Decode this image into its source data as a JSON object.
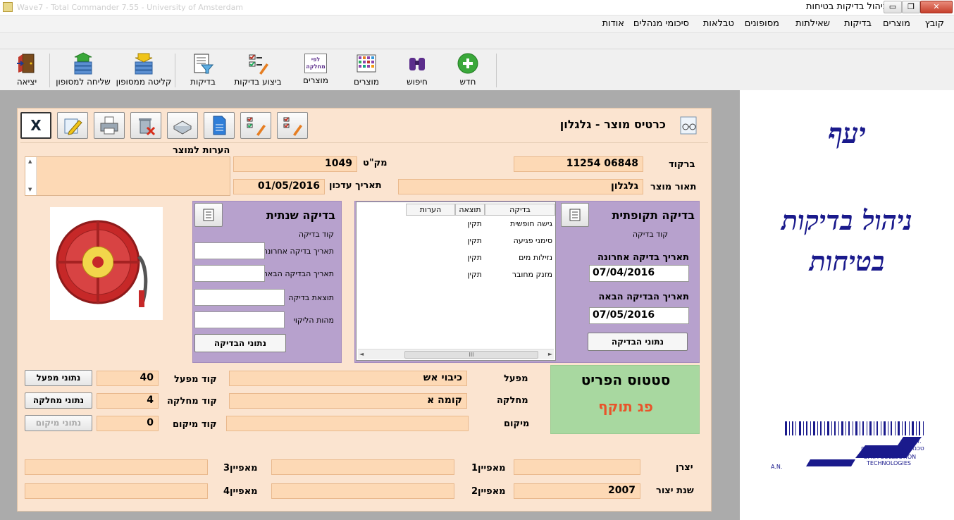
{
  "window": {
    "ghost_title": "Wave7 - Total Commander 7.55 - University of Amsterdam",
    "title": "ניהול בדיקות בטיחות",
    "buttons": {
      "minimize": "▭",
      "maximize": "❐",
      "close": "✕"
    }
  },
  "menu": [
    "קובץ",
    "מוצרים",
    "בדיקות",
    "שאילתות",
    "מסופונים",
    "טבלאות",
    "סיכומי מנהלים",
    "אודות"
  ],
  "toolbar": {
    "items": [
      {
        "label": "חדש",
        "icon": "add-circle-icon"
      },
      {
        "label": "חיפוש",
        "icon": "binoculars-icon"
      },
      {
        "label": "מוצרים",
        "icon": "grid-icon"
      },
      {
        "label": "מוצרים",
        "icon": "by-department-icon",
        "icon_text": "לפי מחלקה"
      },
      {
        "label": "ביצוע בדיקות",
        "icon": "checklist-pen-icon"
      },
      {
        "label": "בדיקות",
        "icon": "report-filter-icon"
      },
      {
        "label": "קליטה ממסופון",
        "icon": "import-stack-icon"
      },
      {
        "label": "שליחה למסופון",
        "icon": "export-stack-icon"
      },
      {
        "label": "יציאה",
        "icon": "exit-door-icon"
      }
    ]
  },
  "brand": {
    "logo_word": "יעף",
    "line1": "ניהול בדיקות",
    "line2": "בטיחות",
    "company_hebrew": "טכנולוגיות איסוף נתונים",
    "company_english_1": "DATA COLLECTION",
    "company_english_2": "TECHNOLOGIES",
    "an": "A.N.",
    "an2": "א.נ."
  },
  "card": {
    "title": "כרטיס מוצר - גלגלון",
    "close_label": "X",
    "notes_label": "הערות למוצר",
    "barcode_label": "ברקוד",
    "barcode": "11254 06848",
    "sku_label": "מק\"ט",
    "sku": "1049",
    "desc_label": "תאור מוצר",
    "desc": "גלגלון",
    "update_date_label": "תאריך עדכון",
    "update_date": "01/05/2016"
  },
  "periodic": {
    "title": "בדיקה תקופתית",
    "code_label": "קוד בדיקה",
    "last_label": "תאריך בדיקה אחרונה",
    "last": "07/04/2016",
    "next_label": "תאריך הבדיקה הבאה",
    "next": "07/05/2016",
    "button": "נתוני הבדיקה",
    "grid_headers": [
      "בדיקה",
      "תוצאה",
      "הערות"
    ],
    "rows": [
      {
        "check": "גישה חופשית",
        "result": "תקין",
        "notes": ""
      },
      {
        "check": "סימני פגיעה",
        "result": "תקין",
        "notes": ""
      },
      {
        "check": "נזילות מים",
        "result": "תקין",
        "notes": ""
      },
      {
        "check": "מזנק מחובר",
        "result": "תקין",
        "notes": ""
      }
    ],
    "scroll_thumb": "III"
  },
  "annual": {
    "title": "בדיקה שנתית",
    "code_label": "קוד בדיקה",
    "last_label": "תאריך בדיקה אחרונה",
    "next_label": "תאריך הבדיקה הבאה",
    "result_label": "תוצאת בדיקה",
    "extinguish_label": "מהות הליקוי",
    "button": "נתוני הבדיקה"
  },
  "status": {
    "title": "סטטוס הפריט",
    "value": "פג תוקף"
  },
  "location": {
    "plant_label": "מפעל",
    "plant": "כיבוי אש",
    "plant_code_label": "קוד מפעל",
    "plant_code": "40",
    "plant_btn": "נתוני מפעל",
    "dept_label": "מחלקה",
    "dept": "קומה א",
    "dept_code_label": "קוד מחלקה",
    "dept_code": "4",
    "dept_btn": "נתוני מחלקה",
    "loc_label": "מיקום",
    "loc": "",
    "loc_code_label": "קוד מיקום",
    "loc_code": "0",
    "loc_btn": "נתוני מיקום"
  },
  "attributes": {
    "maker_label": "יצרן",
    "maker": "",
    "year_label": "שנת יצור",
    "year": "2007",
    "attr1_label": "מאפיין1",
    "attr1": "",
    "attr2_label": "מאפיין2",
    "attr2": "",
    "attr3_label": "מאפיין3",
    "attr3": "",
    "attr4_label": "מאפיין4",
    "attr4": ""
  },
  "colors": {
    "form_bg": "#fbe4d0",
    "field_bg": "#fdd9b5",
    "purple_panel": "#b7a1cd",
    "status_bg": "#a8d8a0",
    "status_text": "#e8542a",
    "brand_blue": "#1a1a8c"
  }
}
